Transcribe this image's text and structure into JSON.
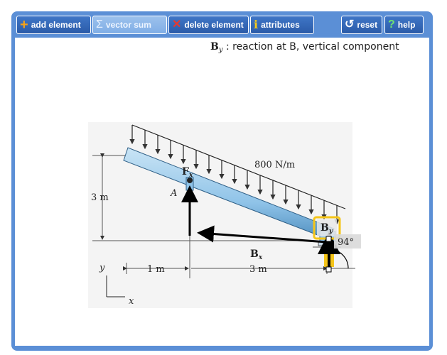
{
  "toolbar": {
    "add_element": "add element",
    "vector_sum": "vector sum",
    "delete_element": "delete element",
    "attributes": "attributes",
    "reset": "reset",
    "help": "help"
  },
  "status": {
    "symbol": "B",
    "subscript": "y",
    "description": " : reaction at B, vertical component"
  },
  "diagram": {
    "load": "800 N/m",
    "dim_height": "3 m",
    "dim_1m": "1 m",
    "dim_3m": "3 m",
    "label_A": "A",
    "label_F": "F",
    "label_F_sub": "x",
    "label_Bx": "B",
    "label_Bx_sub": "x",
    "label_By": "B",
    "label_By_sub": "y",
    "axis_y": "y",
    "axis_x": "x",
    "angle_readout": "94°"
  },
  "colors": {
    "frame": "#5b8fd6",
    "beam": "#8fc3e8",
    "highlight": "#f5c518"
  }
}
